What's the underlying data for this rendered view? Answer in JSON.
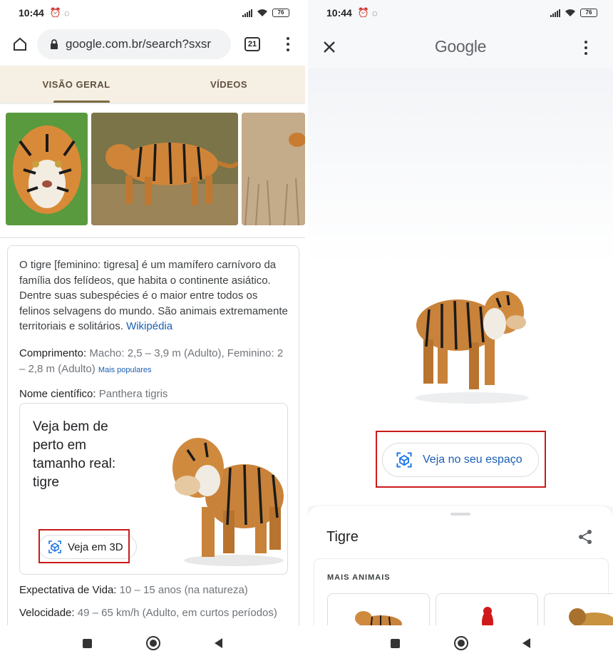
{
  "status": {
    "time": "10:44",
    "battery": "76"
  },
  "left": {
    "url": "google.com.br/search?sxsr",
    "tab_count": "21",
    "tabs": [
      "VISÃO GERAL",
      "VÍDEOS"
    ],
    "description": "O tigre [feminino: tigresa] é um mamífero carnívoro da família dos felídeos, que habita o continente asiático. Dentre suas subespécies é o maior entre todos os felinos selvagens do mundo. São animais extremamente territoriais e solitários.",
    "wiki_link": "Wikipédia",
    "length_label": "Comprimento:",
    "length_value": "Macho: 2,5 – 3,9 m (Adulto), Feminino: 2 – 2,8 m (Adulto)",
    "length_more": "Mais populares",
    "sci_label": "Nome científico:",
    "sci_value": "Panthera tigris",
    "ar_title": "Veja bem de perto em tamanho real: tigre",
    "ar_button": "Veja em 3D",
    "life_label": "Expectativa de Vida:",
    "life_value": "10 – 15 anos (na natureza)",
    "speed_label": "Velocidade:",
    "speed_value": "49 – 65 km/h (Adulto, em curtos períodos)"
  },
  "right": {
    "title": "Google",
    "ar_button": "Veja no seu espaço",
    "sheet_title": "Tigre",
    "more_label": "MAIS ANIMAIS"
  },
  "colors": {
    "accent": "#1a5fb4",
    "highlight": "#cc1a1a"
  }
}
